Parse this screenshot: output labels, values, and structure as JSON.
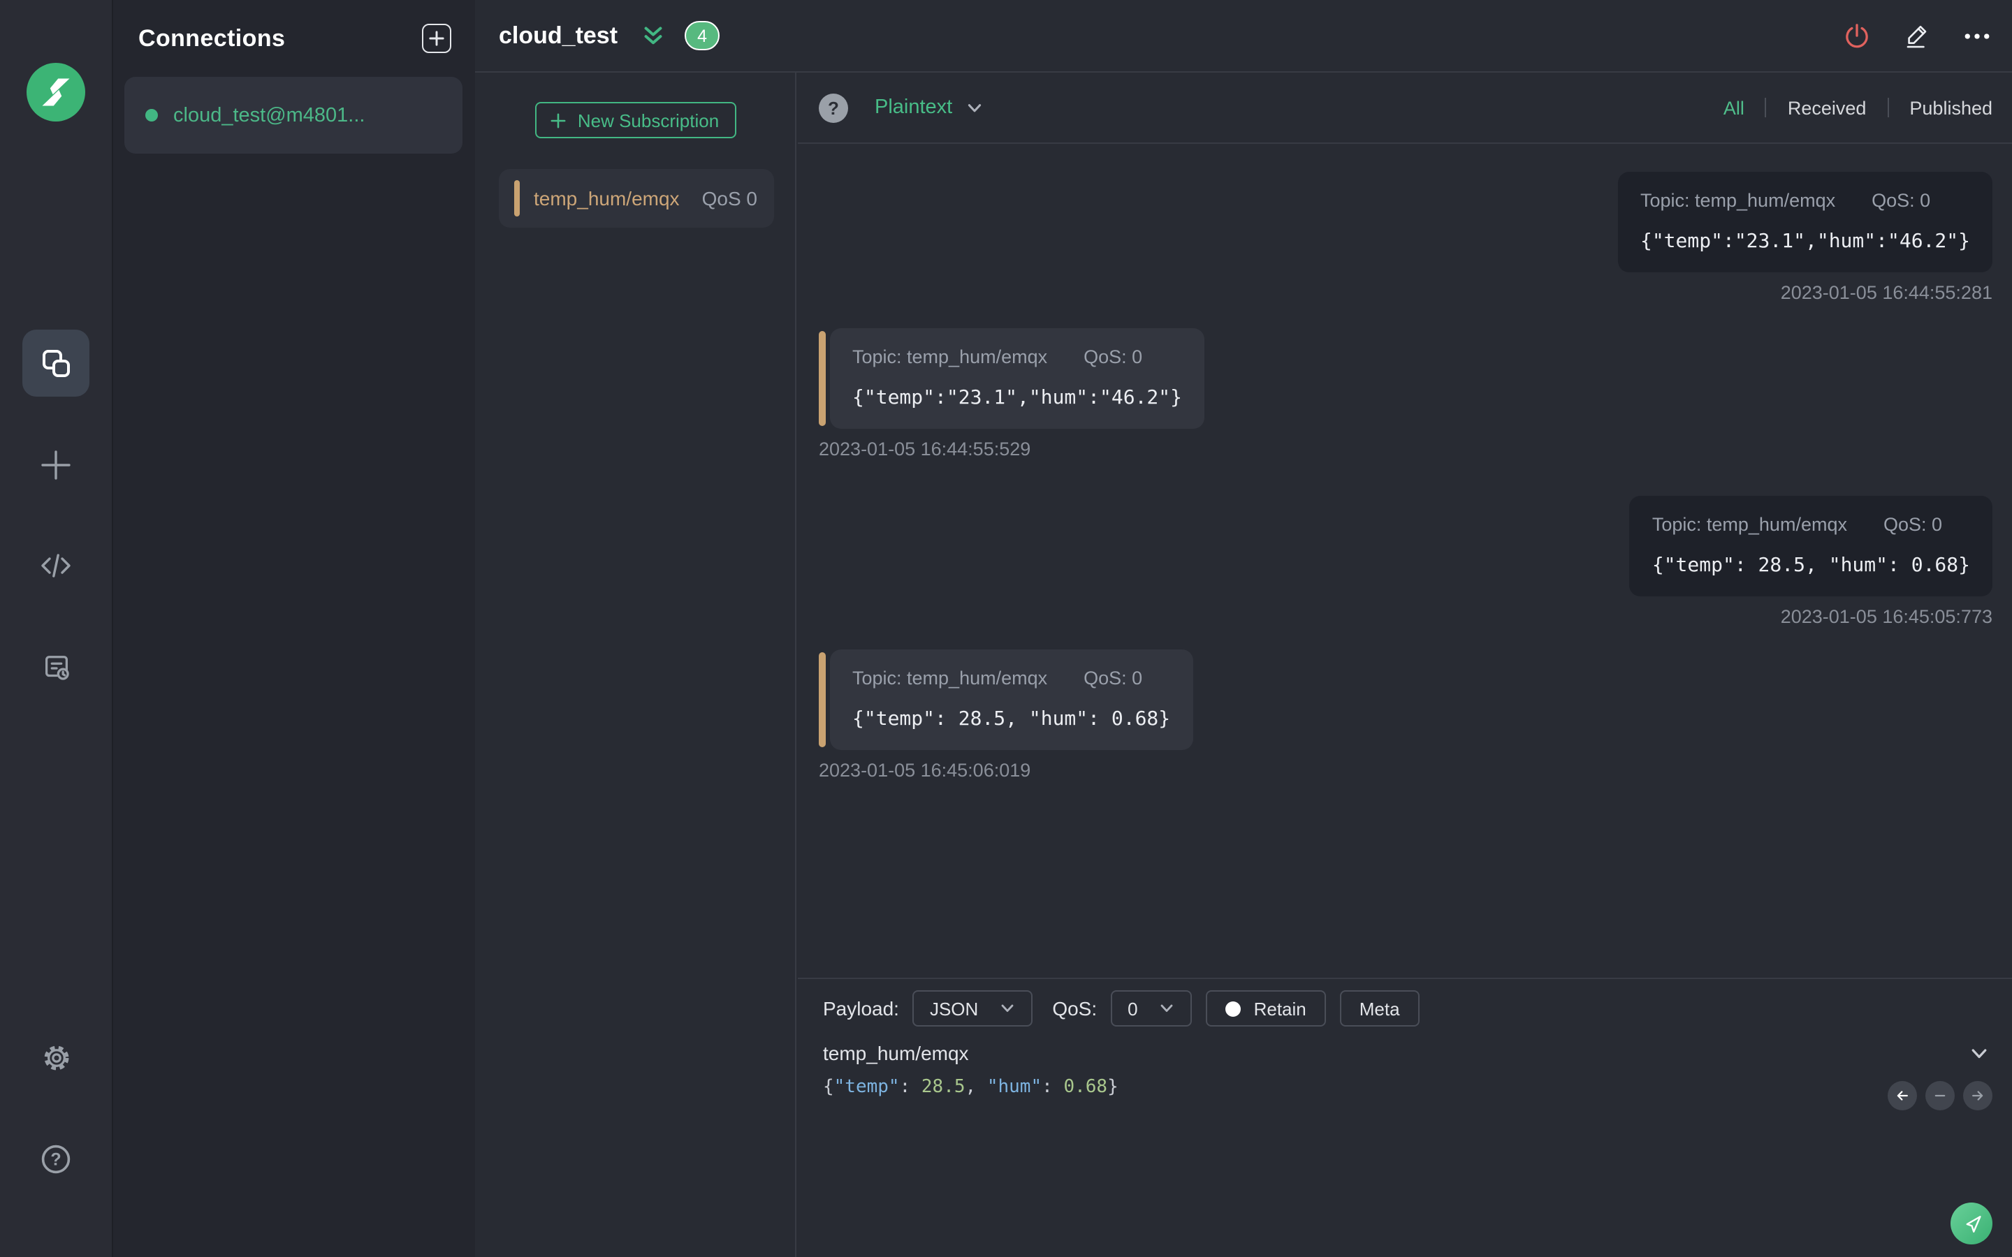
{
  "theme": {
    "accent_green": "#42b783",
    "topic_tan": "#c9a271",
    "disconnect_red": "#e0625e",
    "received_bubble": "#33363f",
    "published_bubble": "#1e2129",
    "json_key_blue": "#7db3e0",
    "json_number_green": "#a9c78d"
  },
  "icons": [
    "mqttx-logo-icon",
    "connections-icon",
    "new-connection-plus-icon",
    "script-code-icon",
    "log-icon",
    "settings-gear-icon",
    "help-question-icon",
    "add-connection-icon",
    "collapse-double-chevron-icon",
    "disconnect-power-icon",
    "edit-pencil-icon",
    "more-ellipsis-icon",
    "plus-icon",
    "payload-format-help-icon",
    "chevron-down-icon",
    "retain-dot-icon",
    "prev-arrow-icon",
    "collapse-minus-icon",
    "next-arrow-icon",
    "send-plane-icon"
  ],
  "connections_panel": {
    "title": "Connections",
    "items": [
      {
        "name": "cloud_test@m4801...",
        "status": "connected"
      }
    ]
  },
  "main_header": {
    "title": "cloud_test",
    "unread_badge": "4"
  },
  "subscriptions_panel": {
    "new_subscription_label": "New Subscription",
    "items": [
      {
        "topic": "temp_hum/emqx",
        "qos": "QoS 0"
      }
    ]
  },
  "message_toolbar": {
    "format_selected": "Plaintext",
    "filters": {
      "all": "All",
      "received": "Received",
      "published": "Published"
    },
    "active_filter": "All"
  },
  "messages": {
    "list": [
      {
        "direction": "published",
        "topic": "Topic: temp_hum/emqx",
        "qos": "QoS: 0",
        "payload": "{\"temp\":\"23.1\",\"hum\":\"46.2\"}",
        "timestamp": "2023-01-05 16:44:55:281"
      },
      {
        "direction": "received",
        "topic": "Topic: temp_hum/emqx",
        "qos": "QoS: 0",
        "payload": "{\"temp\":\"23.1\",\"hum\":\"46.2\"}",
        "timestamp": "2023-01-05 16:44:55:529"
      },
      {
        "direction": "published",
        "topic": "Topic: temp_hum/emqx",
        "qos": "QoS: 0",
        "payload": "{\"temp\": 28.5, \"hum\": 0.68}",
        "timestamp": "2023-01-05 16:45:05:773"
      },
      {
        "direction": "received",
        "topic": "Topic: temp_hum/emqx",
        "qos": "QoS: 0",
        "payload": "{\"temp\": 28.5, \"hum\": 0.68}",
        "timestamp": "2023-01-05 16:45:06:019"
      }
    ]
  },
  "publish_panel": {
    "payload_label": "Payload:",
    "payload_format": "JSON",
    "qos_label": "QoS:",
    "qos_value": "0",
    "retain_label": "Retain",
    "meta_label": "Meta",
    "topic_value": "temp_hum/emqx",
    "payload_editor": {
      "open_brace": "{",
      "key_temp": "\"temp\"",
      "colon_1": ": ",
      "value_temp": "28.5",
      "comma": ", ",
      "key_hum": "\"hum\"",
      "colon_2": ": ",
      "value_hum": "0.68",
      "close_brace": "}"
    }
  }
}
